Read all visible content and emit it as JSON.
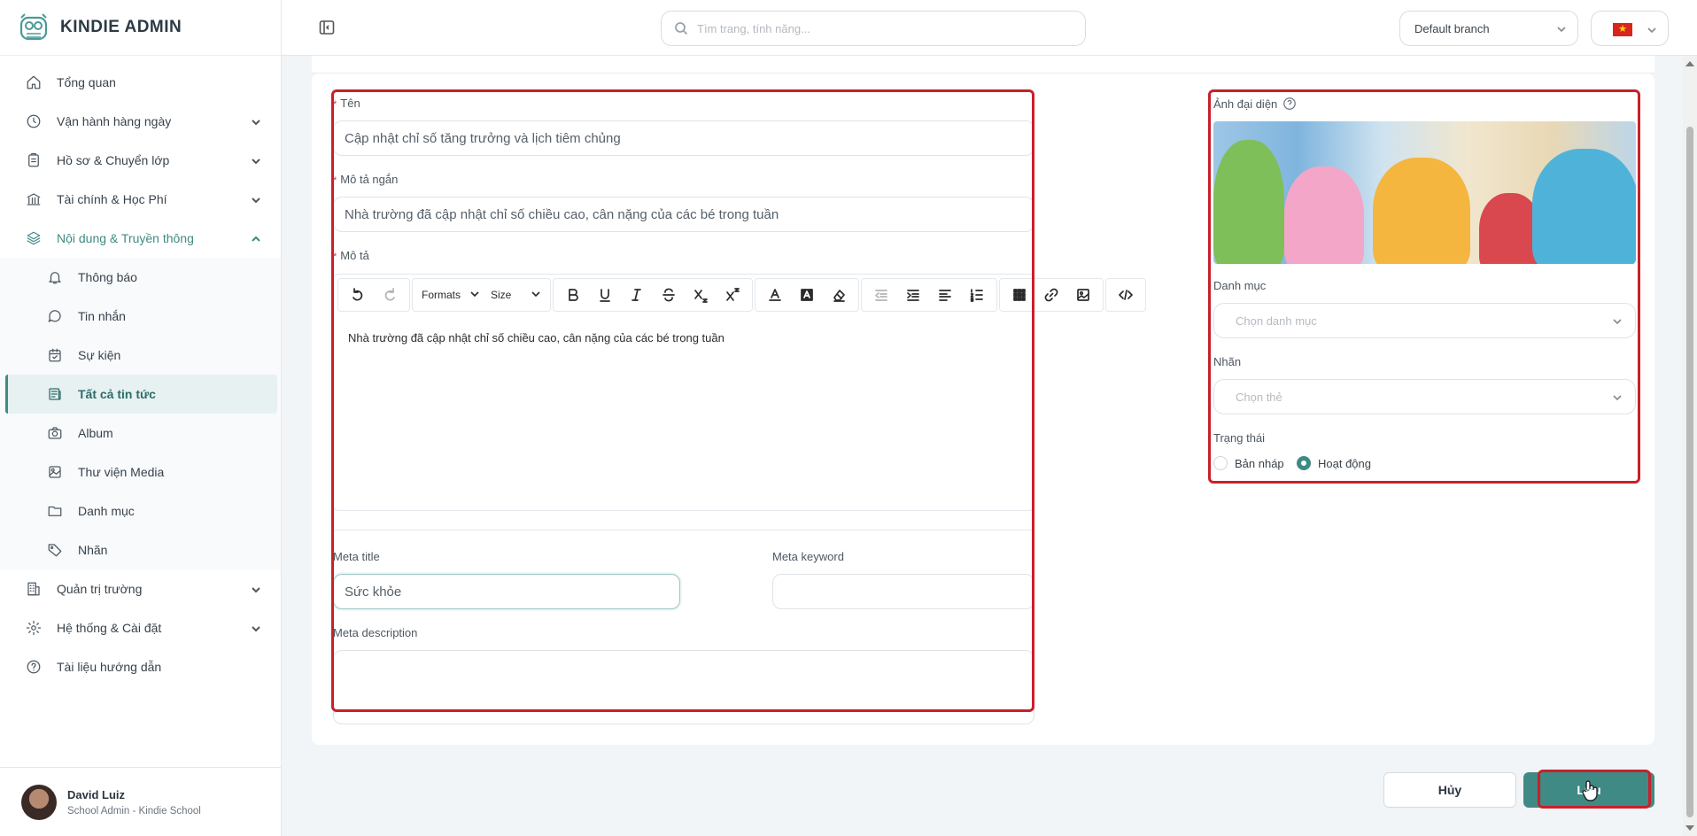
{
  "brand": {
    "name": "KINDIE ADMIN"
  },
  "header": {
    "search_placeholder": "Tìm trang, tính năng...",
    "branch": "Default branch",
    "language_flag": "★"
  },
  "sidebar": {
    "items": [
      {
        "label": "Tổng quan",
        "icon": "home-icon"
      },
      {
        "label": "Vận hành hàng ngày",
        "icon": "clock-icon"
      },
      {
        "label": "Hồ sơ & Chuyển lớp",
        "icon": "clipboard-icon"
      },
      {
        "label": "Tài chính & Học Phí",
        "icon": "bank-icon"
      },
      {
        "label": "Nội dung & Truyền thông",
        "icon": "layers-icon"
      }
    ],
    "sub_items": [
      {
        "label": "Thông báo",
        "icon": "bell-icon"
      },
      {
        "label": "Tin nhắn",
        "icon": "chat-icon"
      },
      {
        "label": "Sự kiện",
        "icon": "calendar-icon"
      },
      {
        "label": "Tất cả tin tức",
        "icon": "newspaper-icon"
      },
      {
        "label": "Album",
        "icon": "camera-icon"
      },
      {
        "label": "Thư viện Media",
        "icon": "image-icon"
      },
      {
        "label": "Danh mục",
        "icon": "folder-icon"
      },
      {
        "label": "Nhãn",
        "icon": "tag-icon"
      }
    ],
    "bottom_items": [
      {
        "label": "Quản trị trường",
        "icon": "building-icon"
      },
      {
        "label": "Hệ thống & Cài đặt",
        "icon": "gear-icon"
      },
      {
        "label": "Tài liệu hướng dẫn",
        "icon": "help-circle-icon"
      }
    ]
  },
  "user": {
    "name": "David Luiz",
    "role": "School Admin - Kindie School"
  },
  "form": {
    "name_label": "Tên",
    "name_value": "Cập nhật chỉ số tăng trưởng và lịch tiêm chủng",
    "short_desc_label": "Mô tả ngắn",
    "short_desc_value": "Nhà trường đã cập nhật chỉ số chiều cao, cân nặng của các bé trong tuần",
    "desc_label": "Mô tả",
    "editor": {
      "formats": "Formats",
      "size": "Size",
      "content": "Nhà trường đã cập nhật chỉ số chiều cao, cân nặng của các bé trong tuần"
    },
    "meta_title_label": "Meta title",
    "meta_title_value": "Sức khỏe",
    "meta_keyword_label": "Meta keyword",
    "meta_keyword_value": "",
    "meta_desc_label": "Meta description",
    "avatar_label": "Ảnh đại diện",
    "category_label": "Danh mục",
    "category_placeholder": "Chọn danh mục",
    "tag_label": "Nhãn",
    "tag_placeholder": "Chọn thẻ",
    "status_label": "Trạng thái",
    "status_options": [
      "Bản nháp",
      "Hoạt động"
    ],
    "status_selected": "Hoạt động"
  },
  "actions": {
    "cancel": "Hủy",
    "save": "Lưu"
  },
  "colors": {
    "accent": "#3f8a85",
    "highlight": "#c8202b"
  }
}
